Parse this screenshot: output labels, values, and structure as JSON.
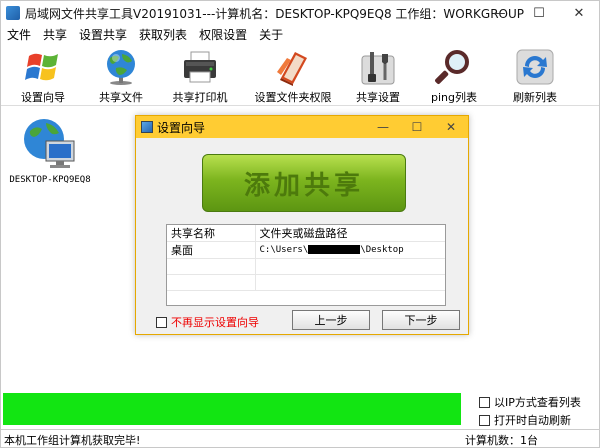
{
  "window": {
    "title": "局域网文件共享工具V20191031---计算机名：DESKTOP-KPQ9EQ8  工作组：WORKGROUP",
    "minimize": "—",
    "maximize": "☐",
    "close": "✕"
  },
  "menu": [
    "文件",
    "共享",
    "设置共享",
    "获取列表",
    "权限设置",
    "关于"
  ],
  "toolbar": [
    {
      "label": "设置向导",
      "icon": "windows-logo-icon"
    },
    {
      "label": "共享文件",
      "icon": "globe-icon"
    },
    {
      "label": "共享打印机",
      "icon": "printer-icon"
    },
    {
      "label": "设置文件夹权限",
      "icon": "book-folder-icon"
    },
    {
      "label": "共享设置",
      "icon": "tools-icon"
    },
    {
      "label": "ping列表",
      "icon": "magnifier-icon"
    },
    {
      "label": "刷新列表",
      "icon": "refresh-icon"
    }
  ],
  "computers": [
    {
      "name": "DESKTOP-KPQ9EQ8"
    }
  ],
  "dialog": {
    "title": "设置向导",
    "minimize": "—",
    "maximize": "☐",
    "close": "✕",
    "add_share": "添加共享",
    "table": {
      "headers": [
        "共享名称",
        "文件夹或磁盘路径"
      ],
      "rows": [
        {
          "name": "桌面",
          "path_prefix": "C:\\Users\\",
          "path_suffix": "\\Desktop"
        }
      ]
    },
    "dont_show": "不再显示设置向导",
    "prev": "上一步",
    "next": "下一步"
  },
  "bottom": {
    "progress_color": "#12e512",
    "option_ip": "以IP方式查看列表",
    "option_second": "打开时自动刷新",
    "status": "本机工作组计算机获取完毕!",
    "count": "计算机数：1台"
  }
}
